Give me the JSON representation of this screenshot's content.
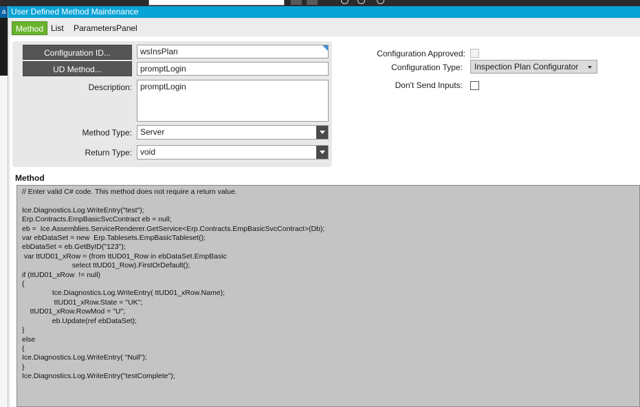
{
  "window": {
    "title": "User Defined Method Maintenance",
    "left_strip_glyph": "a"
  },
  "tabs": [
    {
      "label": "Method",
      "active": true
    },
    {
      "label": "List",
      "active": false
    },
    {
      "label": "ParametersPanel",
      "active": false
    }
  ],
  "form": {
    "configuration_id": {
      "button_label": "Configuration ID...",
      "value": "wsInsPlan"
    },
    "ud_method": {
      "button_label": "UD Method...",
      "value": "promptLogin"
    },
    "description": {
      "label": "Description:",
      "value": "promptLogin"
    },
    "method_type": {
      "label": "Method Type:",
      "value": "Server"
    },
    "return_type": {
      "label": "Return Type:",
      "value": "void"
    },
    "configuration_approved": {
      "label": "Configuration Approved:",
      "checked": false,
      "enabled": false
    },
    "configuration_type": {
      "label": "Configuration Type:",
      "value": "Inspection Plan Configurator"
    },
    "dont_send_inputs": {
      "label": "Don't Send Inputs:",
      "checked": false
    }
  },
  "method_section": {
    "title": "Method",
    "code": "// Enter valid C# code. This method does not require a return value.\n\nIce.Diagnostics.Log.WriteEntry(\"test\");\nErp.Contracts.EmpBasicSvcContract eb = null;\neb =  Ice.Assemblies.ServiceRenderer.GetService<Erp.Contracts.EmpBasicSvcContract>(Db);\nvar ebDataSet = new  Erp.Tablesets.EmpBasicTableset();\nebDataSet = eb.GetByID(\"123\");\n var ttUD01_xRow = (from ttUD01_Row in ebDataSet.EmpBasic\n                         select ttUD01_Row).FirstOrDefault();\nif (ttUD01_xRow  != null)\n{\n               Ice.Diagnostics.Log.WriteEntry( ttUD01_xRow.Name);\n                ttUD01_xRow.State = \"UK\";\n    ttUD01_xRow.RowMod = \"U\";\n               eb.Update(ref ebDataSet);\n}\nelse\n{\nIce.Diagnostics.Log.WriteEntry( \"Null\");\n}\nIce.Diagnostics.Log.WriteEntry(\"testComplete\");"
  },
  "colors": {
    "title_bar": "#0aa3d6",
    "active_tab": "#6ab42d",
    "dark_button": "#555555",
    "code_background": "#c4c4c4"
  }
}
